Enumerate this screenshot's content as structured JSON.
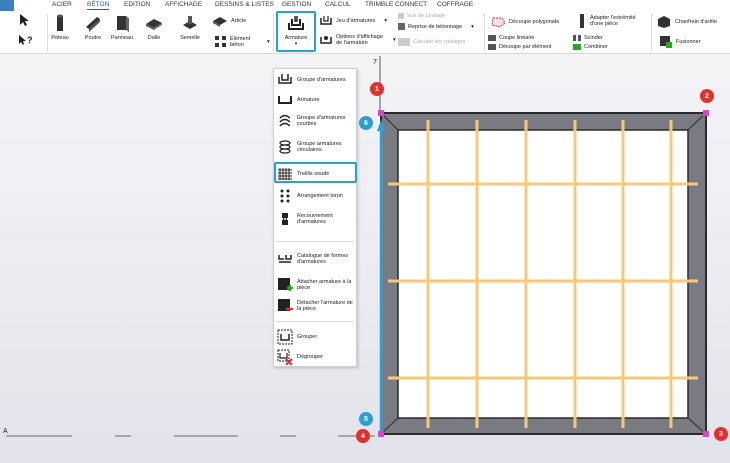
{
  "tabs": [
    "ACIER",
    "BÉTON",
    "EDITION",
    "AFFICHAGE",
    "DESSINS & LISTES",
    "GESTION",
    "CALCUL",
    "TRIMBLE CONNECT",
    "COFFRAGE"
  ],
  "active_tab": "BÉTON",
  "ribbon": {
    "poteau": "Poteau",
    "poutre": "Poutre",
    "panneau": "Panneau",
    "dalle": "Dalle",
    "semelle": "Semelle",
    "article": "Article",
    "element_beton": "Élément béton",
    "armature": "Armature",
    "jeu_armatures": "Jeu d'armatures",
    "options_affichage": "Options d'affichage de l'armature",
    "vue_coulage": "Vue de coulage",
    "reprise_betonnage": "Reprise de bétonnage",
    "calculer_coulages": "Calculer les coulages",
    "decoupe_polygonale": "Découpe polygonale",
    "adapter_extremite": "Adapter l'extrémité d'une pièce",
    "coupe_lineaire": "Coupe linéaire",
    "decoupe_par_element": "Découpe par élément",
    "scinder": "Scinder",
    "combiner": "Combiner",
    "chanfrein": "Chanfrein d'arête",
    "fusionner": "Fusionner"
  },
  "menu": {
    "items": [
      "Groupe d'armatures",
      "Armature",
      "Groupe d'armatures courbes",
      "Groupe armatures circulaires",
      "Treillis soudé",
      "Arrangement toron",
      "Recouvrement d'armatures",
      "Catalogue de formes d'armatures",
      "Attacher armature à la pièce",
      "Détacher l'armature de la pièce",
      "Grouper",
      "Dégrouper"
    ]
  },
  "viewport": {
    "axis_label": "A",
    "grid_label": "7",
    "points_red": [
      "1",
      "2",
      "3",
      "4"
    ],
    "points_blue": [
      "5",
      "6"
    ]
  },
  "colors": {
    "accent": "#2aa1d6",
    "bar": "#f5c977",
    "slab": "#7a7a82",
    "point": "#e03030",
    "tab_active": "#1d5fa8"
  }
}
